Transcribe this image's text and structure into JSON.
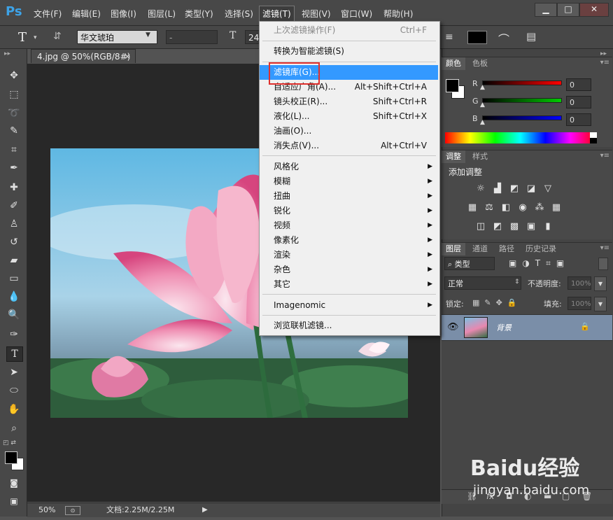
{
  "app": {
    "logo": "Ps"
  },
  "menubar": {
    "items": [
      "文件(F)",
      "编辑(E)",
      "图像(I)",
      "图层(L)",
      "类型(Y)",
      "选择(S)",
      "滤镜(T)",
      "视图(V)",
      "窗口(W)",
      "帮助(H)"
    ],
    "active": "滤镜(T)",
    "window_buttons": [
      "▁",
      "□",
      "✕"
    ]
  },
  "options_bar": {
    "tool_glyph": "T",
    "font_family": "华文琥珀",
    "font_style": "-",
    "font_size": "24"
  },
  "document": {
    "tab_title": "4.jpg @ 50%(RGB/8#)",
    "zoom": "50%",
    "doc_info": "文档:2.25M/2.25M"
  },
  "filter_menu": {
    "items": [
      {
        "label": "上次滤镜操作(F)",
        "shortcut": "Ctrl+F",
        "disabled": true
      },
      {
        "label": "转换为智能滤镜(S)"
      },
      {
        "label": "滤镜库(G)...",
        "highlight": true
      },
      {
        "label": "自适应广角(A)...",
        "shortcut": "Alt+Shift+Ctrl+A"
      },
      {
        "label": "镜头校正(R)...",
        "shortcut": "Shift+Ctrl+R"
      },
      {
        "label": "液化(L)...",
        "shortcut": "Shift+Ctrl+X"
      },
      {
        "label": "油画(O)..."
      },
      {
        "label": "消失点(V)...",
        "shortcut": "Alt+Ctrl+V"
      },
      {
        "label": "风格化",
        "submenu": true
      },
      {
        "label": "模糊",
        "submenu": true
      },
      {
        "label": "扭曲",
        "submenu": true
      },
      {
        "label": "锐化",
        "submenu": true
      },
      {
        "label": "视频",
        "submenu": true
      },
      {
        "label": "像素化",
        "submenu": true
      },
      {
        "label": "渲染",
        "submenu": true
      },
      {
        "label": "杂色",
        "submenu": true
      },
      {
        "label": "其它",
        "submenu": true
      },
      {
        "label": "Imagenomic",
        "submenu": true
      },
      {
        "label": "浏览联机滤镜..."
      }
    ]
  },
  "color_panel": {
    "tabs": [
      "颜色",
      "色板"
    ],
    "channels": [
      {
        "name": "R",
        "value": "0",
        "color": "#ff0000"
      },
      {
        "name": "G",
        "value": "0",
        "color": "#00cc00"
      },
      {
        "name": "B",
        "value": "0",
        "color": "#0000ff"
      }
    ]
  },
  "adjust_panel": {
    "tabs": [
      "调整",
      "样式"
    ],
    "title": "添加调整"
  },
  "layers_panel": {
    "tabs": [
      "图层",
      "通道",
      "路径",
      "历史记录"
    ],
    "filter_kind": "类型",
    "blend_mode": "正常",
    "opacity_label": "不透明度:",
    "opacity_value": "100%",
    "lock_label": "锁定:",
    "fill_label": "填充:",
    "fill_value": "100%",
    "layer_name": "背景"
  },
  "watermark": {
    "brand": "Baidu经验",
    "url": "jingyan.baidu.com"
  },
  "colors": {
    "accent": "#3399ff",
    "highlight_box": "#e0302d"
  }
}
